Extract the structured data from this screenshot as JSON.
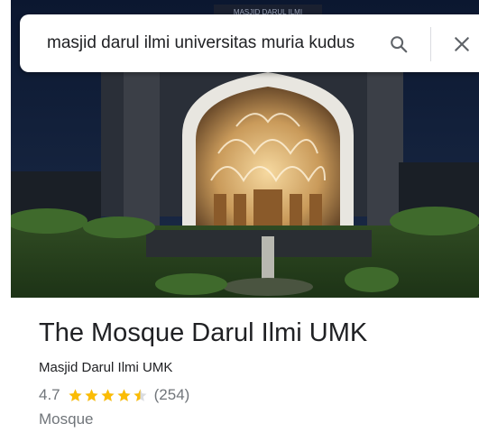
{
  "search": {
    "value": "masjid darul ilmi universitas muria kudus",
    "search_icon": "search-icon",
    "close_icon": "close-icon"
  },
  "photo": {
    "subject": "mosque-photo",
    "sign_text": "MASJID DARUL ILMI"
  },
  "place": {
    "title": "The Mosque Darul Ilmi UMK",
    "subtitle": "Masjid Darul Ilmi UMK",
    "rating": "4.7",
    "stars": 4.7,
    "review_count": "(254)",
    "category": "Mosque"
  },
  "colors": {
    "star": "#fbbc04",
    "secondary_text": "#70757a",
    "primary_text": "#202124"
  }
}
